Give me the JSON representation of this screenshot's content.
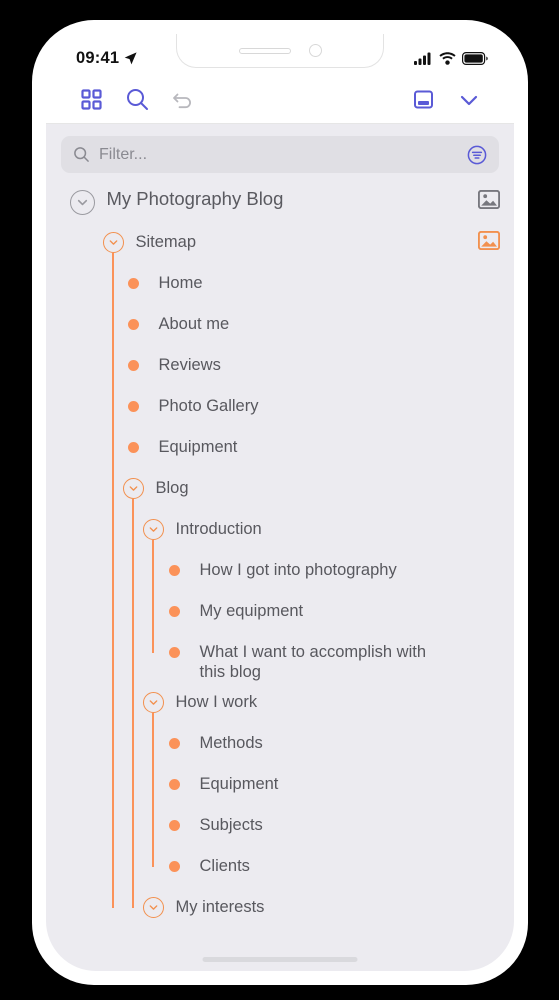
{
  "status_bar": {
    "time": "09:41",
    "location_icon": "location-arrow-icon",
    "signal_icon": "cellular-signal-icon",
    "wifi_icon": "wifi-icon",
    "battery_icon": "battery-full-icon"
  },
  "toolbar": {
    "items": [
      {
        "name": "grid-view-button",
        "icon": "grid-icon",
        "color": "#5a5ad6",
        "enabled": true
      },
      {
        "name": "search-button",
        "icon": "search-icon",
        "color": "#5a5ad6",
        "enabled": true
      },
      {
        "name": "undo-button",
        "icon": "undo-arrow-icon",
        "color": "#b8b8bd",
        "enabled": false
      },
      {
        "name": "panel-layout-button",
        "icon": "panel-bottom-icon",
        "color": "#5a5ad6",
        "enabled": true
      },
      {
        "name": "collapse-button",
        "icon": "chevron-down-icon",
        "color": "#5a5ad6",
        "enabled": true
      }
    ]
  },
  "filter": {
    "placeholder": "Filter...",
    "value": "",
    "search_icon": "search-icon",
    "options_icon": "filter-options-icon",
    "options_color": "#5a5ad6"
  },
  "colors": {
    "accent_orange": "#fb9259",
    "accent_purple": "#5a5ad6",
    "background": "#ecebf0",
    "text": "#58585e"
  },
  "tree": {
    "nodes": [
      {
        "label": "My Photography Blog",
        "level": 0,
        "type": "branch",
        "marker": "grey-chevron",
        "expanded": true,
        "image_icon": "image-placeholder-icon",
        "image_color": "#77777e"
      },
      {
        "label": "Sitemap",
        "level": 1,
        "type": "branch",
        "marker": "orange-chevron",
        "expanded": true,
        "image_icon": "image-placeholder-icon",
        "image_color": "#f2904e"
      },
      {
        "label": "Home",
        "level": 2,
        "type": "leaf",
        "marker": "orange-dot"
      },
      {
        "label": "About me",
        "level": 2,
        "type": "leaf",
        "marker": "orange-dot"
      },
      {
        "label": "Reviews",
        "level": 2,
        "type": "leaf",
        "marker": "orange-dot"
      },
      {
        "label": "Photo Gallery",
        "level": 2,
        "type": "leaf",
        "marker": "orange-dot"
      },
      {
        "label": "Equipment",
        "level": 2,
        "type": "leaf",
        "marker": "orange-dot"
      },
      {
        "label": "Blog",
        "level": 2,
        "type": "branch",
        "marker": "orange-chevron",
        "expanded": true
      },
      {
        "label": "Introduction",
        "level": 3,
        "type": "branch",
        "marker": "orange-chevron",
        "expanded": true
      },
      {
        "label": "How I got into photography",
        "level": 4,
        "type": "leaf",
        "marker": "orange-dot"
      },
      {
        "label": "My equipment",
        "level": 4,
        "type": "leaf",
        "marker": "orange-dot"
      },
      {
        "label": "What I want to accomplish with this blog",
        "level": 4,
        "type": "leaf",
        "marker": "orange-dot"
      },
      {
        "label": "How I work",
        "level": 3,
        "type": "branch",
        "marker": "orange-chevron",
        "expanded": true
      },
      {
        "label": "Methods",
        "level": 4,
        "type": "leaf",
        "marker": "orange-dot"
      },
      {
        "label": "Equipment",
        "level": 4,
        "type": "leaf",
        "marker": "orange-dot"
      },
      {
        "label": "Subjects",
        "level": 4,
        "type": "leaf",
        "marker": "orange-dot"
      },
      {
        "label": "Clients",
        "level": 4,
        "type": "leaf",
        "marker": "orange-dot"
      },
      {
        "label": "My interests",
        "level": 3,
        "type": "branch",
        "marker": "orange-chevron",
        "expanded": true
      }
    ]
  },
  "home_indicator": "home-indicator-bar"
}
